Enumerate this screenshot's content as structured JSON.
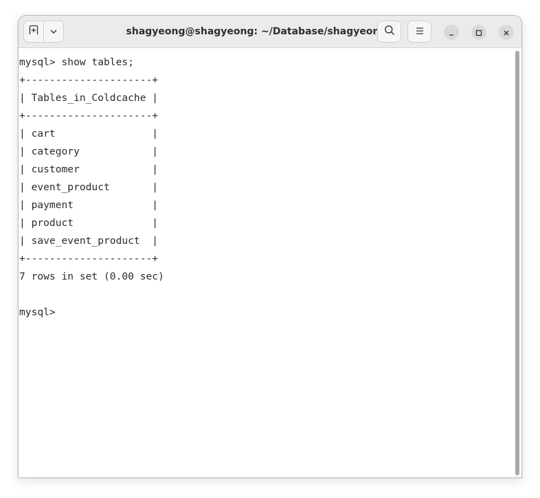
{
  "window": {
    "title": "shagyeong@shagyeong: ~/Database/shagyeong"
  },
  "titlebar": {
    "new_tab_icon": "new-tab-icon",
    "dropdown_icon": "chevron-down-icon",
    "search_icon": "search-icon",
    "menu_icon": "hamburger-menu-icon",
    "minimize_icon": "minimize-icon",
    "maximize_icon": "maximize-icon",
    "close_icon": "close-icon"
  },
  "terminal": {
    "lines": [
      "mysql> show tables;",
      "+---------------------+",
      "| Tables_in_Coldcache |",
      "+---------------------+",
      "| cart                |",
      "| category            |",
      "| customer            |",
      "| event_product       |",
      "| payment             |",
      "| product             |",
      "| save_event_product  |",
      "+---------------------+",
      "7 rows in set (0.00 sec)",
      "",
      "mysql> "
    ]
  },
  "colors": {
    "titlebar_bg": "#ebebeb",
    "terminal_bg": "#ffffff",
    "terminal_fg": "#2b2b2b"
  }
}
